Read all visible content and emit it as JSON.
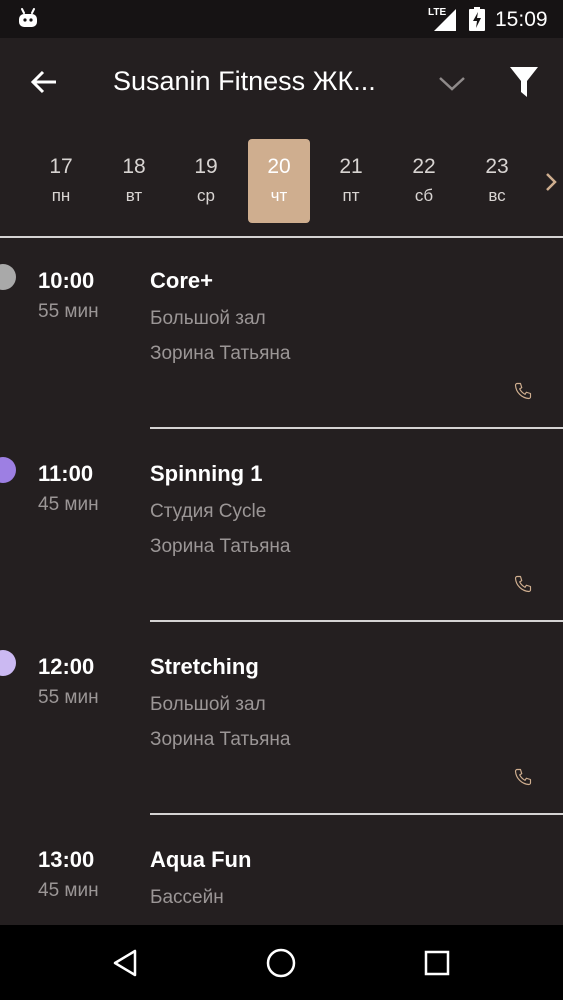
{
  "status_bar": {
    "network": "LTE",
    "time": "15:09"
  },
  "toolbar": {
    "title": "Susanin Fitness ЖК...",
    "icons": [
      "back-arrow-icon",
      "chevron-down-icon",
      "filter-icon"
    ]
  },
  "days": [
    {
      "num": "17",
      "weekday": "пн",
      "selected": false
    },
    {
      "num": "18",
      "weekday": "вт",
      "selected": false
    },
    {
      "num": "19",
      "weekday": "ср",
      "selected": false
    },
    {
      "num": "20",
      "weekday": "чт",
      "selected": true
    },
    {
      "num": "21",
      "weekday": "пт",
      "selected": false
    },
    {
      "num": "22",
      "weekday": "сб",
      "selected": false
    },
    {
      "num": "23",
      "weekday": "вс",
      "selected": false
    }
  ],
  "sessions": [
    {
      "time": "10:00",
      "duration": "55 мин",
      "name": "Core+",
      "room": "Большой зал",
      "trainer": "Зорина Татьяна",
      "color": "#a9a9a9"
    },
    {
      "time": "11:00",
      "duration": "45 мин",
      "name": "Spinning 1",
      "room": "Студия Cycle",
      "trainer": "Зорина Татьяна",
      "color": "#9d7fe3"
    },
    {
      "time": "12:00",
      "duration": "55 мин",
      "name": "Stretching",
      "room": "Большой зал",
      "trainer": "Зорина Татьяна",
      "color": "#cbb9f2"
    },
    {
      "time": "13:00",
      "duration": "45 мин",
      "name": "Aqua Fun",
      "room": "Бассейн",
      "trainer": "",
      "color": ""
    }
  ],
  "colors": {
    "background": "#241f20",
    "accent": "#cfae8f",
    "secondary_text": "#9b9696"
  },
  "nav": {
    "icons": [
      "back-triangle-icon",
      "home-circle-icon",
      "recents-square-icon"
    ]
  }
}
